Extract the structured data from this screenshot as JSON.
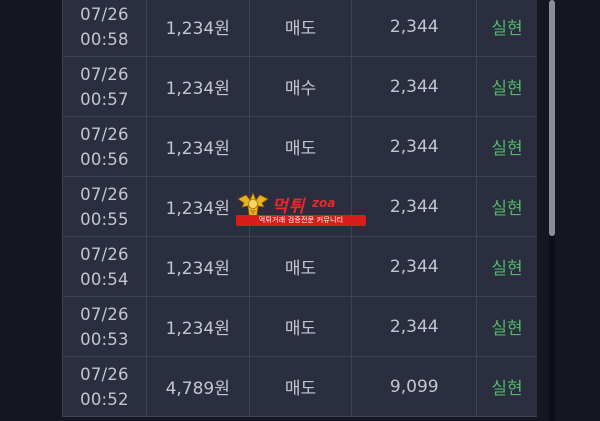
{
  "rows": [
    {
      "date": "07/26",
      "time": "00:58",
      "price": "1,234원",
      "type": "매도",
      "qty": "2,344",
      "status": "실현"
    },
    {
      "date": "07/26",
      "time": "00:57",
      "price": "1,234원",
      "type": "매수",
      "qty": "2,344",
      "status": "실현"
    },
    {
      "date": "07/26",
      "time": "00:56",
      "price": "1,234원",
      "type": "매도",
      "qty": "2,344",
      "status": "실현"
    },
    {
      "date": "07/26",
      "time": "00:55",
      "price": "1,234원",
      "type": "",
      "qty": "2,344",
      "status": "실현"
    },
    {
      "date": "07/26",
      "time": "00:54",
      "price": "1,234원",
      "type": "매도",
      "qty": "2,344",
      "status": "실현"
    },
    {
      "date": "07/26",
      "time": "00:53",
      "price": "1,234원",
      "type": "매도",
      "qty": "2,344",
      "status": "실현"
    },
    {
      "date": "07/26",
      "time": "00:52",
      "price": "4,789원",
      "type": "매도",
      "qty": "9,099",
      "status": "실현"
    }
  ],
  "watermark": {
    "logo_text": "먹튀",
    "logo_tail": "zoa",
    "tagline": "먹튀거래 검증전문 커뮤니티"
  },
  "colors": {
    "background": "#141722",
    "table": "#2a2e3f",
    "status_green": "#4fb86b",
    "watermark_red": "#e52a2a"
  }
}
